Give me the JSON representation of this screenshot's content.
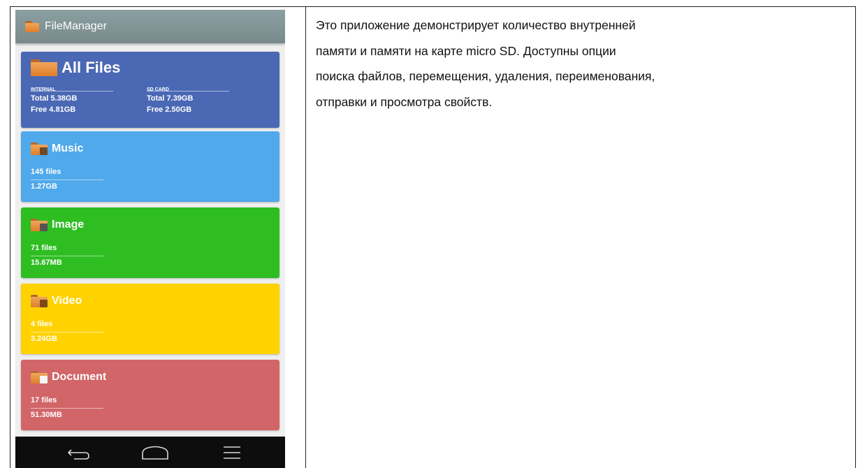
{
  "app": {
    "title": "FileManager"
  },
  "cards": {
    "all_files": {
      "name": "All Files",
      "internal_label": "INTERNAL",
      "internal_total": "Total 5.38GB",
      "internal_free": "Free 4.81GB",
      "sd_label": "SD CARD",
      "sd_total": "Total 7.39GB",
      "sd_free": "Free 2.50GB",
      "color": "#4a68b4"
    },
    "music": {
      "name": "Music",
      "count": "145 files",
      "size": "1.27GB",
      "color": "#4fa9ea"
    },
    "image": {
      "name": "Image",
      "count": "71 files",
      "size": "15.67MB",
      "color": "#2ebe22"
    },
    "video": {
      "name": "Video",
      "count": "4 files",
      "size": "3.24GB",
      "color": "#ffd200"
    },
    "document": {
      "name": "Document",
      "count": "17 files",
      "size": "51.30MB",
      "color": "#d26568"
    }
  },
  "navbar": {
    "back_icon": "back-icon",
    "home_icon": "home-icon",
    "menu_icon": "menu-icon"
  },
  "description": {
    "line1": "Это приложение демонстрирует количество внутренней",
    "line2": "памяти и памяти на карте micro SD. Доступны опции",
    "line3": "поиска файлов, перемещения, удаления, переименования,",
    "line4": "отправки и просмотра свойств."
  }
}
